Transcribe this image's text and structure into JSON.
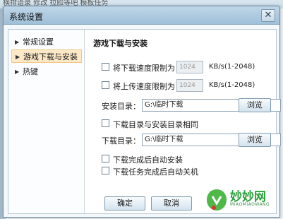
{
  "background": {
    "text": "横排语录  修改  拉脸等吧  模板任务"
  },
  "window": {
    "title": "系统设置",
    "close_symbol": "✕"
  },
  "sidebar": {
    "items": [
      {
        "label": "常规设置",
        "active": false
      },
      {
        "label": "游戏下载与安装",
        "active": true
      },
      {
        "label": "热键",
        "active": false
      }
    ]
  },
  "main": {
    "section_title": "游戏下载与安装",
    "download_limit": {
      "label": "将下载速度限制为：",
      "value": "1024",
      "unit": "KB/s(1-2048)",
      "checked": false
    },
    "upload_limit": {
      "label": "将上传速度限制为：",
      "value": "1024",
      "unit": "KB/s(1-2048)",
      "checked": false
    },
    "install_dir": {
      "label": "安装目录：",
      "value": "G:\\临时下载",
      "browse": "浏览"
    },
    "same_dir": {
      "label": "下载目录与安装目录相同",
      "checked": false
    },
    "download_dir": {
      "label": "下载目录：",
      "value": "G:\\临时下载",
      "browse": "浏览"
    },
    "auto_install": {
      "label": "下载完成后自动安装",
      "checked": false
    },
    "auto_shutdown": {
      "label": "下载任务完成后自动关机",
      "checked": false
    }
  },
  "footer": {
    "ok": "确定",
    "cancel": "取消"
  },
  "watermark": {
    "name": "妙妙网",
    "sub": "MIAOMIAOWANG"
  },
  "colors": {
    "active_item_bg": "#fde9c7",
    "logo_green": "#2aa13a"
  }
}
